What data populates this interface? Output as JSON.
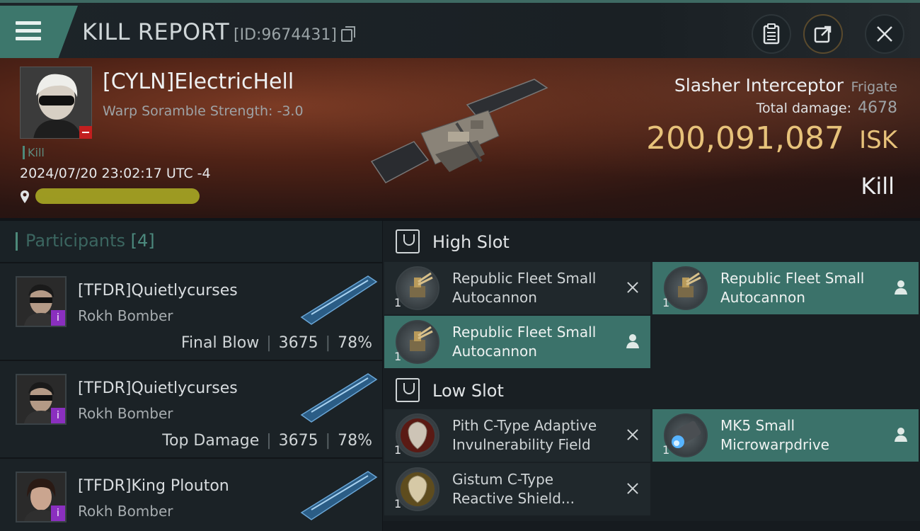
{
  "header": {
    "title": "KILL REPORT",
    "id_text": "[ID:9674431]"
  },
  "victim": {
    "name": "[CYLN]ElectricHell",
    "subtitle": "Warp Soramble Strength: -3.0",
    "tag": "Kill",
    "datetime": "2024/07/20 23:02:17 UTC -4"
  },
  "ship": {
    "name": "Slasher Interceptor",
    "class": "Frigate",
    "damage_label": "Total damage:",
    "damage_value": "4678",
    "isk_value": "200,091,087",
    "isk_label": "ISK",
    "result": "Kill"
  },
  "participants": {
    "label": "Participants",
    "count": "[4]",
    "rows": [
      {
        "name": "[TFDR]Quietlycurses",
        "ship": "Rokh Bomber",
        "role": "Final Blow",
        "damage": "3675",
        "percent": "78%"
      },
      {
        "name": "[TFDR]Quietlycurses",
        "ship": "Rokh Bomber",
        "role": "Top Damage",
        "damage": "3675",
        "percent": "78%"
      },
      {
        "name": "[TFDR]King Plouton",
        "ship": "Rokh Bomber"
      }
    ]
  },
  "fitting": {
    "high_slot_label": "High Slot",
    "low_slot_label": "Low Slot",
    "high": [
      {
        "qty": "1",
        "line1": "Republic Fleet Small",
        "line2": "Autocannon",
        "action": "close"
      },
      {
        "qty": "1",
        "line1": "Republic Fleet Small",
        "line2": "Autocannon",
        "action": "pilot"
      },
      {
        "qty": "1",
        "line1": "Republic Fleet Small",
        "line2": "Autocannon",
        "action": "pilot"
      }
    ],
    "low": [
      {
        "qty": "1",
        "line1": "Pith C-Type Adaptive",
        "line2": "Invulnerability Field",
        "action": "close"
      },
      {
        "qty": "1",
        "line1": "MK5 Small",
        "line2": "Microwarpdrive",
        "action": "pilot"
      },
      {
        "qty": "1",
        "line1": "Gistum C-Type",
        "line2": "Reactive Shield...",
        "action": "close"
      }
    ]
  },
  "colors": {
    "accent": "#3d776c",
    "isk_gold": "#e7c27a"
  }
}
